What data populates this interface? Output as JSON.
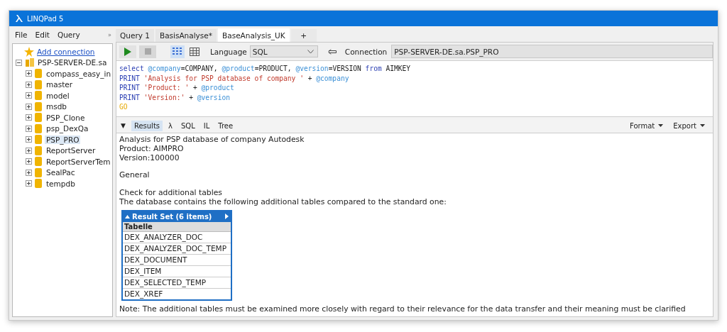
{
  "window": {
    "title": "LINQPad 5"
  },
  "menu": [
    {
      "label": "File"
    },
    {
      "label": "Edit"
    },
    {
      "label": "Query"
    }
  ],
  "menu_overflow": "»",
  "tree": {
    "add_connection": "Add connection",
    "server": {
      "label": "PSP-SERVER-DE.sa",
      "expanded": true,
      "children": [
        {
          "label": "compass_easy_in",
          "selected": false,
          "expanded": false
        },
        {
          "label": "master",
          "selected": false,
          "expanded": false
        },
        {
          "label": "model",
          "selected": false,
          "expanded": false
        },
        {
          "label": "msdb",
          "selected": false,
          "expanded": false
        },
        {
          "label": "PSP_Clone",
          "selected": false,
          "expanded": false
        },
        {
          "label": "psp_DexQa",
          "selected": false,
          "expanded": false
        },
        {
          "label": "PSP_PRO",
          "selected": true,
          "expanded": false
        },
        {
          "label": "ReportServer",
          "selected": false,
          "expanded": false
        },
        {
          "label": "ReportServerTem",
          "selected": false,
          "expanded": false
        },
        {
          "label": "SealPac",
          "selected": false,
          "expanded": false
        },
        {
          "label": "tempdb",
          "selected": false,
          "expanded": false
        }
      ]
    }
  },
  "tabs": [
    {
      "label": "Query 1",
      "selected": false
    },
    {
      "label": "BasisAnalyse*",
      "selected": false
    },
    {
      "label": "BaseAnalysis_UK",
      "selected": true
    }
  ],
  "new_tab": "+",
  "toolbar": {
    "run_disabled": false,
    "stop_disabled": true,
    "view_modes": [
      {
        "kind": "rich",
        "selected": true
      },
      {
        "kind": "grid",
        "selected": false
      }
    ],
    "language_label": "Language",
    "language": "SQL",
    "connection_label": "Connection",
    "connection": "PSP-SERVER-DE.sa.PSP_PRO"
  },
  "code": [
    [
      {
        "kind": "keyword",
        "text": "select "
      },
      {
        "kind": "variable",
        "text": "@company"
      },
      {
        "kind": "plain",
        "text": "=COMPANY, "
      },
      {
        "kind": "variable",
        "text": "@product"
      },
      {
        "kind": "plain",
        "text": "=PRODUCT, "
      },
      {
        "kind": "variable",
        "text": "@version"
      },
      {
        "kind": "plain",
        "text": "=VERSION "
      },
      {
        "kind": "keyword",
        "text": "from"
      },
      {
        "kind": "plain",
        "text": " AIMKEY"
      }
    ],
    [
      {
        "kind": "keyword",
        "text": "PRINT "
      },
      {
        "kind": "string",
        "text": "'Analysis for PSP database of company '"
      },
      {
        "kind": "plain",
        "text": " + "
      },
      {
        "kind": "variable",
        "text": "@company"
      }
    ],
    [
      {
        "kind": "keyword",
        "text": "PRINT "
      },
      {
        "kind": "string",
        "text": "'Product: '"
      },
      {
        "kind": "plain",
        "text": " + "
      },
      {
        "kind": "variable",
        "text": "@product"
      }
    ],
    [
      {
        "kind": "keyword",
        "text": "PRINT "
      },
      {
        "kind": "string",
        "text": "'Version:'"
      },
      {
        "kind": "plain",
        "text": " + "
      },
      {
        "kind": "variable",
        "text": "@version"
      }
    ],
    [
      {
        "kind": "go",
        "text": "GO"
      }
    ]
  ],
  "results_collapse": "▼",
  "result_tabs": [
    {
      "label": "Results",
      "selected": true
    },
    {
      "label": "λ",
      "selected": false
    },
    {
      "label": "SQL",
      "selected": false
    },
    {
      "label": "IL",
      "selected": false
    },
    {
      "label": "Tree",
      "selected": false
    }
  ],
  "result_menus": [
    {
      "label": "Format"
    },
    {
      "label": "Export"
    }
  ],
  "output": {
    "paragraphs": [
      [
        "Analysis for PSP database of company Autodesk",
        "Product: AIMPRO",
        "Version:100000"
      ],
      [
        "General"
      ],
      [
        "Check for additional tables",
        "The database contains the following additional tables compared to the standard one:"
      ]
    ],
    "result_set": {
      "title": "Result Set (6 items)",
      "column": "Tabelle",
      "rows": [
        "DEX_ANALYZER_DOC",
        "DEX_ANALYZER_DOC_TEMP",
        "DEX_DOCUMENT",
        "DEX_ITEM",
        "DEX_SELECTED_TEMP",
        "DEX_XREF"
      ]
    },
    "note": "Note: The additional tables must be examined more closely with regard to their relevance for the data transfer and their meaning must be clarified"
  }
}
